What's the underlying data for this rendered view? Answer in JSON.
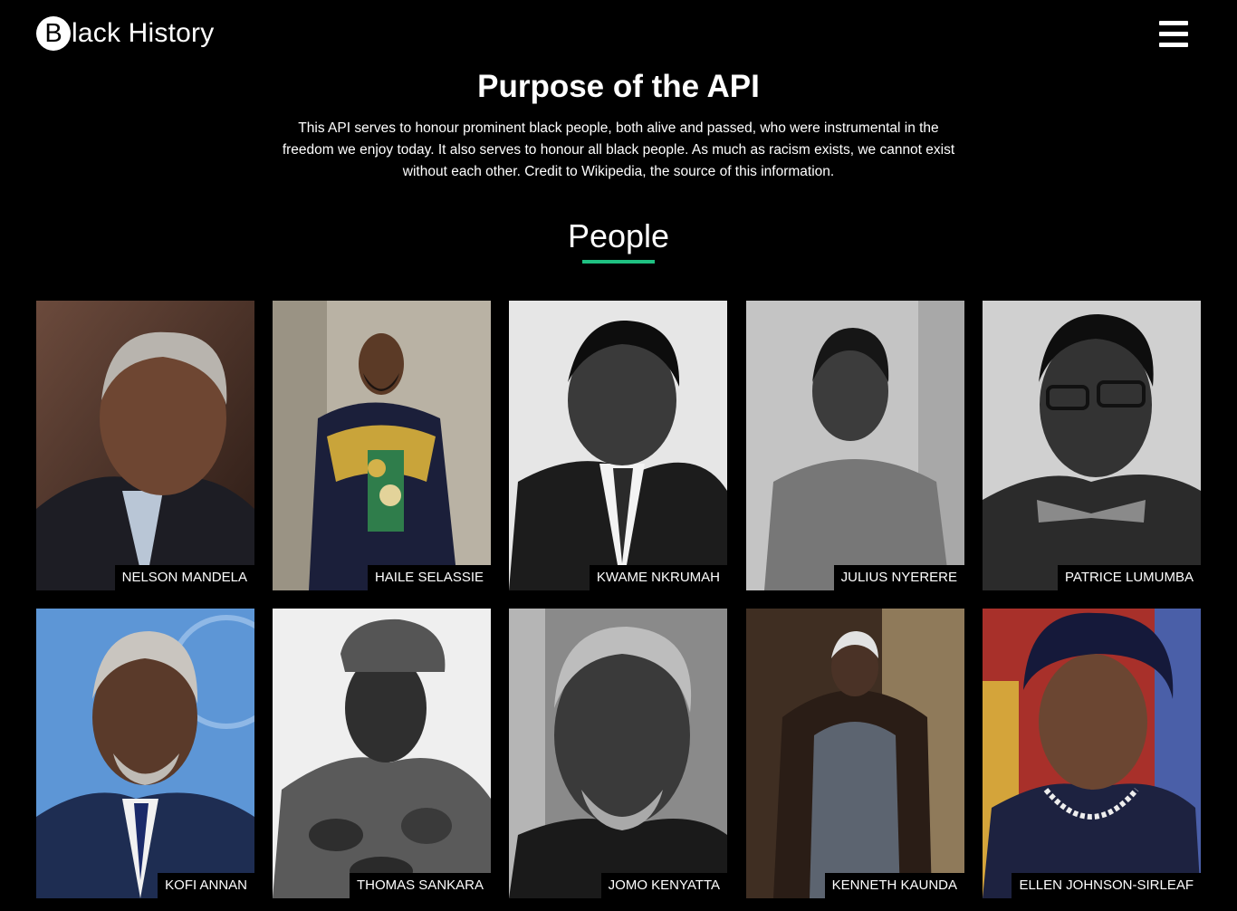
{
  "header": {
    "logo_letter": "B",
    "logo_rest": "lack History"
  },
  "purpose": {
    "title": "Purpose of the API",
    "text": "This API serves to honour prominent black people, both alive and passed, who were instrumental in the freedom we enjoy today. It also serves to honour all black people. As much as racism exists, we cannot exist without each other. Credit to Wikipedia, the source of this information."
  },
  "people": {
    "title": "People",
    "accent": "#1fc182",
    "cards": [
      {
        "name": "NELSON MANDELA"
      },
      {
        "name": "HAILE SELASSIE"
      },
      {
        "name": "KWAME NKRUMAH"
      },
      {
        "name": "JULIUS NYERERE"
      },
      {
        "name": "PATRICE LUMUMBA"
      },
      {
        "name": "KOFI ANNAN"
      },
      {
        "name": "THOMAS SANKARA"
      },
      {
        "name": "JOMO KENYATTA"
      },
      {
        "name": "KENNETH KAUNDA"
      },
      {
        "name": "ELLEN JOHNSON-SIRLEAF"
      }
    ]
  }
}
